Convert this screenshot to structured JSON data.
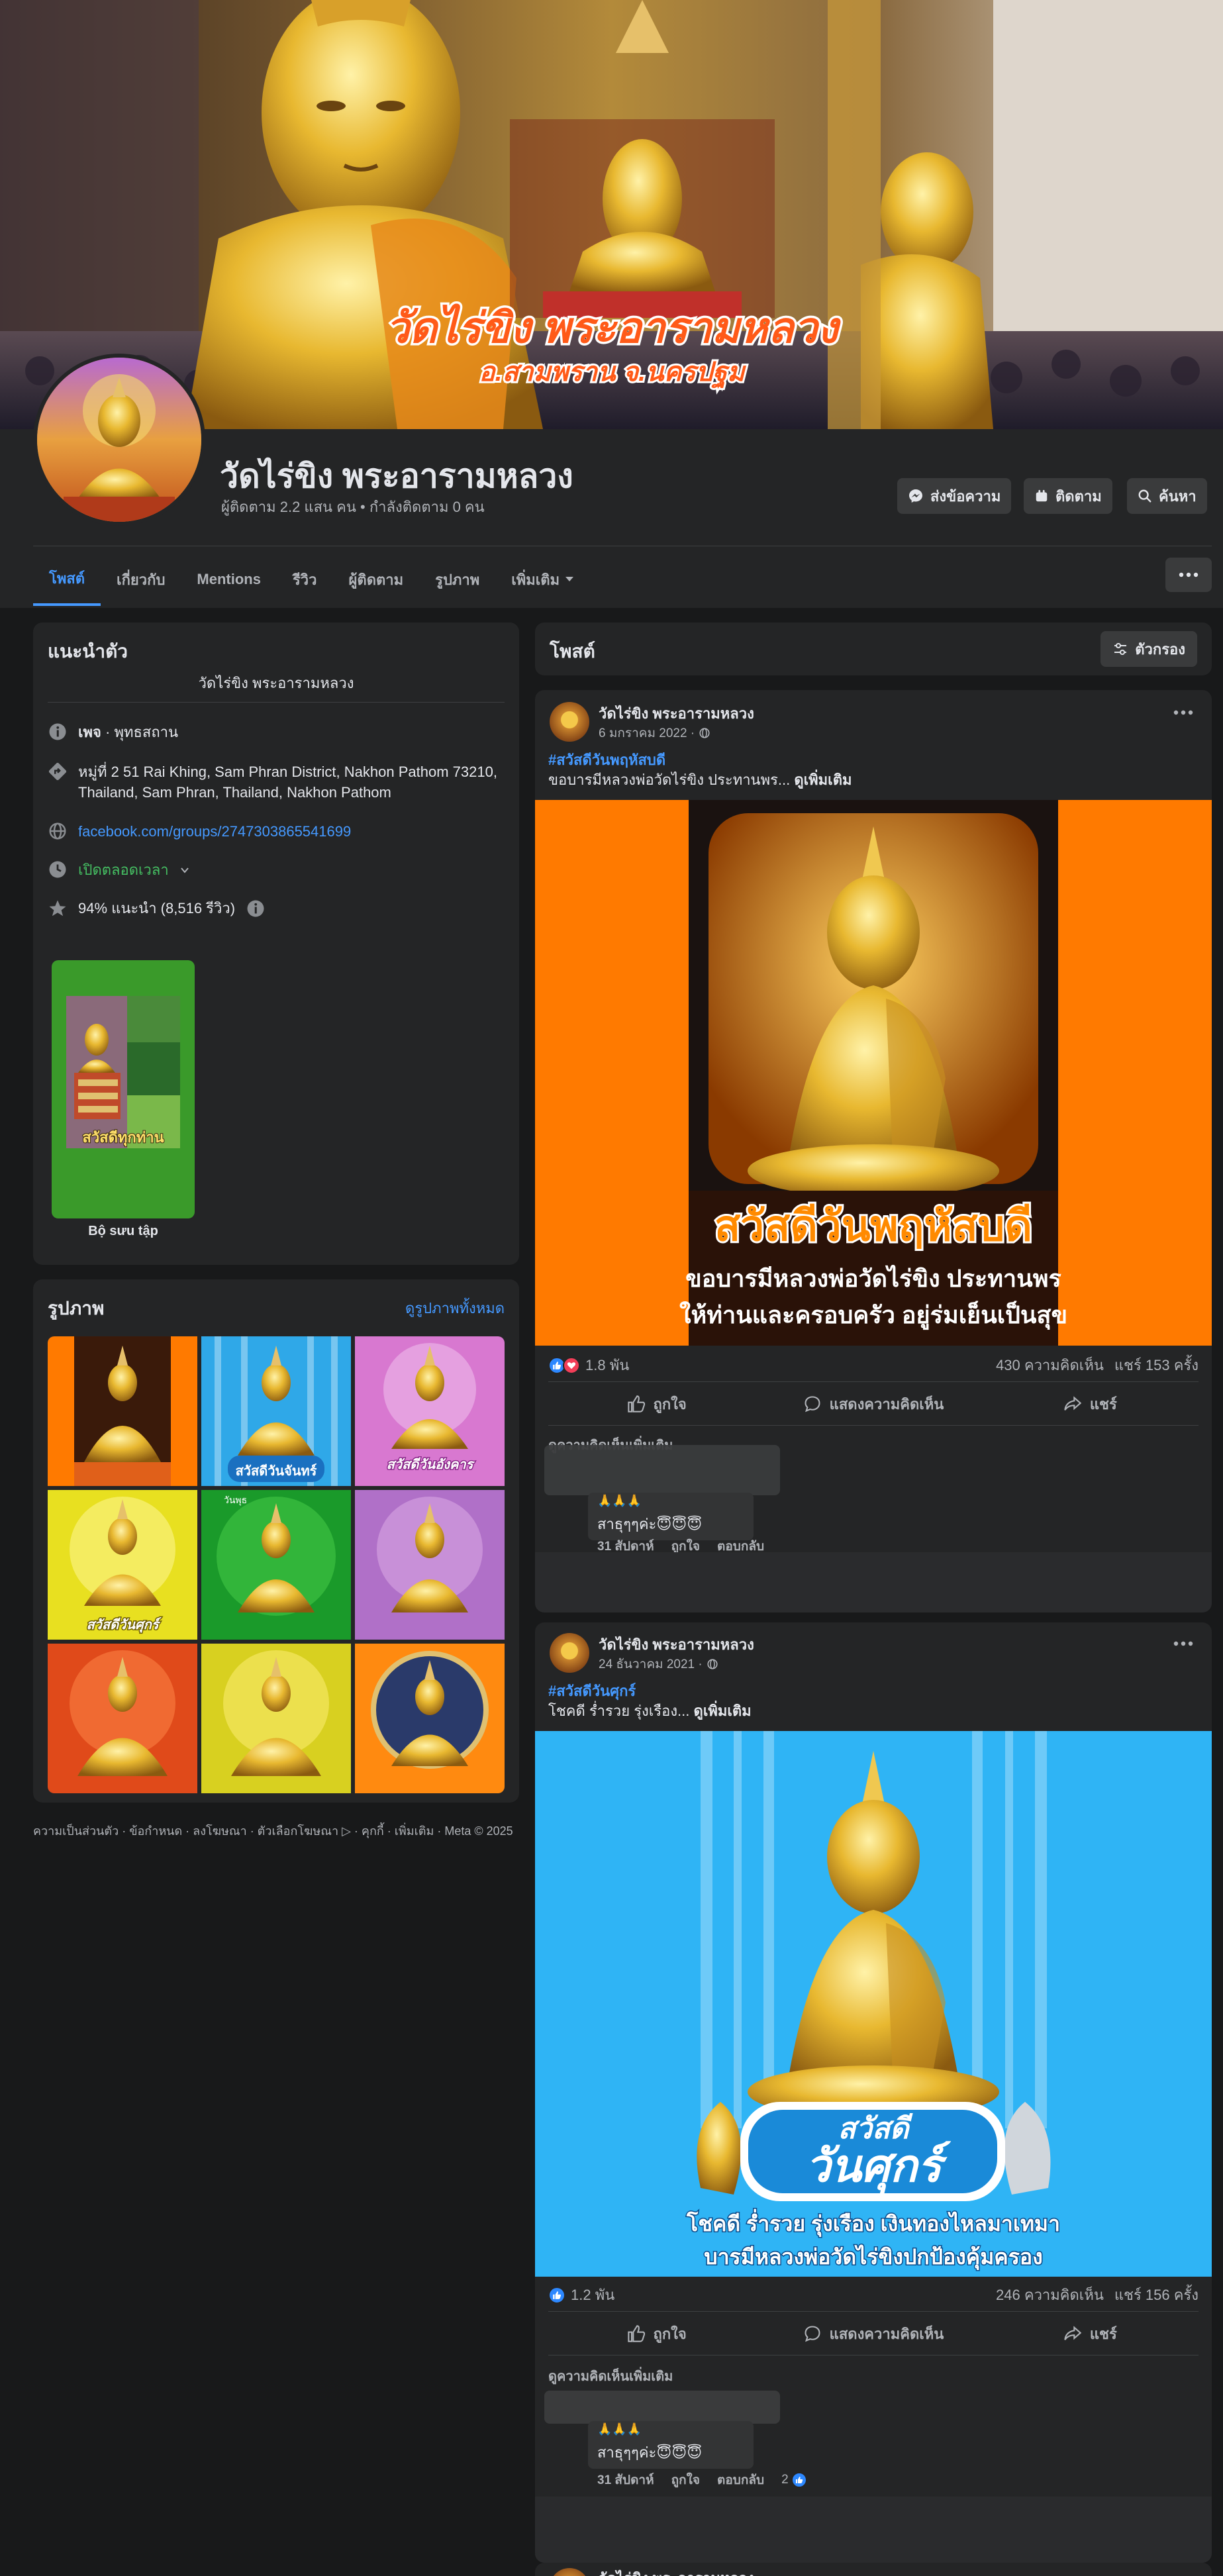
{
  "cover": {
    "title_line1": "วัดไร่ขิง พระอารามหลวง",
    "title_line2": "อ.สามพราน จ.นครปฐม"
  },
  "profile": {
    "name": "วัดไร่ขิง พระอารามหลวง",
    "subtitle": "ผู้ติดตาม 2.2 แสน คน • กำลังติดตาม 0 คน"
  },
  "actions": {
    "message": "ส่งข้อความ",
    "follow": "ติดตาม",
    "search": "ค้นหา"
  },
  "tabs": [
    {
      "label": "โพสต์"
    },
    {
      "label": "เกี่ยวกับ"
    },
    {
      "label": "Mentions"
    },
    {
      "label": "รีวิว"
    },
    {
      "label": "ผู้ติดตาม"
    },
    {
      "label": "รูปภาพ"
    },
    {
      "label": "เพิ่มเติม"
    }
  ],
  "intro": {
    "title": "แนะนำตัว",
    "bio": "วัดไร่ขิง พระอารามหลวง",
    "category_bold": "เพจ",
    "category_rest": " · พุทธสถาน",
    "address": "หมู่ที่ 2 51 Rai Khing, Sam Phran District, Nakhon Pathom 73210, Thailand, Sam Phran, Thailand, Nakhon Pathom",
    "website": "facebook.com/groups/2747303865541699",
    "hours": "เปิดตลอดเวลา",
    "rating": "94% แนะนำ (8,516 รีวิว)",
    "collection_label": "Bộ sưu tập",
    "collection_caption": "สวัสดีทุกท่าน"
  },
  "photos": {
    "title": "รูปภาพ",
    "see_all": "ดูรูปภาพทั้งหมด",
    "captions": [
      "",
      "สวัสดีวันจันทร์",
      "สวัสดีวันอังคาร",
      "สวัสดีวันศุกร์",
      "วันพุธ",
      "",
      "",
      "",
      ""
    ]
  },
  "footer": {
    "text": "ความเป็นส่วนตัว · ข้อกำหนด · ลงโฆษณา · ตัวเลือกโฆษณา ▷ · คุกกี้ · เพิ่มเติม · Meta © 2025"
  },
  "posts_header": {
    "title": "โพสต์",
    "filter": "ตัวกรอง"
  },
  "posts": [
    {
      "author": "วัดไร่ขิง พระอารามหลวง",
      "time": "6 มกราคม 2022 ·",
      "hashtag": "#สวัสดีวันพฤหัสบดี",
      "text": "ขอบารมีหลวงพ่อวัดไร่ขิง ประทานพร...",
      "see_more": "ดูเพิ่มเติม",
      "image_title": "สวัสดีวันพฤหัสบดี",
      "image_line1": "ขอบารมีหลวงพ่อวัดไร่ขิง ประทานพร",
      "image_line2": "ให้ท่านและครอบครัว อยู่ร่มเย็นเป็นสุข",
      "reactions": "1.8 พัน",
      "comments": "430 ความคิดเห็น",
      "shares": "แชร์ 153 ครั้ง",
      "like": "ถูกใจ",
      "comment": "แสดงความคิดเห็น",
      "share": "แชร์",
      "more_comments": "ดูความคิดเห็นเพิ่มเติม",
      "comment_text": "สาธุๆๆค่ะ😇😇😇",
      "comment_emoji": "🙏🙏🙏",
      "comment_time": "31 สัปดาห์",
      "comment_like": "ถูกใจ",
      "comment_reply": "ตอบกลับ"
    },
    {
      "author": "วัดไร่ขิง พระอารามหลวง",
      "time": "24 ธันวาคม 2021 ·",
      "hashtag": "#สวัสดีวันศุกร์",
      "text": "โชคดี ร่ำรวย รุ่งเรือง...",
      "see_more": "ดูเพิ่มเติม",
      "image_title_top": "สวัสดี",
      "image_title": "วันศุกร์",
      "image_line1": "โชคดี ร่ำรวย รุ่งเรือง เงินทองไหลมาเทมา",
      "image_line2": "บารมีหลวงพ่อวัดไร่ขิงปกป้องคุ้มครอง",
      "reactions": "1.2 พัน",
      "comments": "246 ความคิดเห็น",
      "shares": "แชร์ 156 ครั้ง",
      "like": "ถูกใจ",
      "comment": "แสดงความคิดเห็น",
      "share": "แชร์",
      "more_comments": "ดูความคิดเห็นเพิ่มเติม",
      "comment_text": "สาธุๆๆค่ะ😇😇😇",
      "comment_emoji": "🙏🙏🙏",
      "comment_time": "31 สัปดาห์",
      "comment_like": "ถูกใจ",
      "comment_reply": "ตอบกลับ",
      "comment_likes": "2"
    },
    {
      "author": "วัดไร่ขิง พระอารามหลวง"
    }
  ],
  "colors": {
    "accent": "#4599ff",
    "bg": "#18191a",
    "card": "#242526",
    "thursday_orange": "#ff7a00",
    "friday_blue": "#2fb4f5"
  }
}
